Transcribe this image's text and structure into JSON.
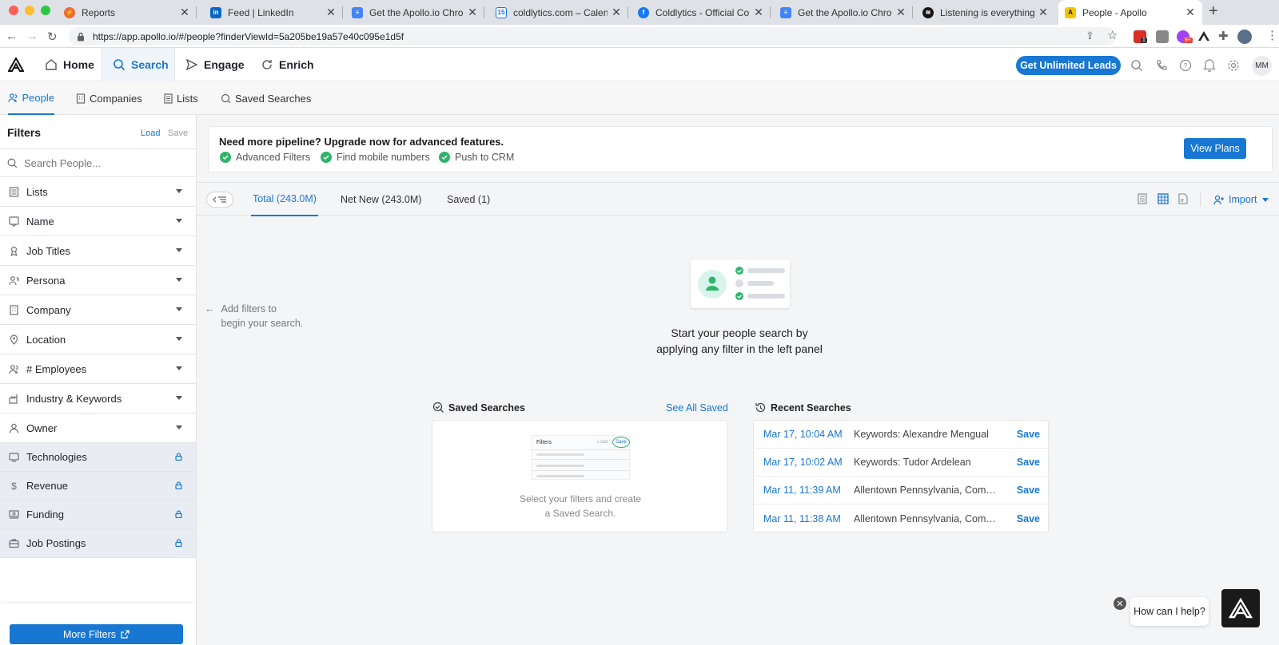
{
  "browser": {
    "tabs": [
      {
        "title": "Reports",
        "favicon": "reports-icon",
        "color": "#f06a35"
      },
      {
        "title": "Feed | LinkedIn",
        "favicon": "linkedin-icon",
        "color": "#0a66c2"
      },
      {
        "title": "Get the Apollo.io Chrome",
        "favicon": "google-docs-icon",
        "color": "#4285f4"
      },
      {
        "title": "coldlytics.com – Calendar",
        "favicon": "google-calendar-icon",
        "color": "#1a73e8"
      },
      {
        "title": "Coldlytics - Official Comm",
        "favicon": "facebook-icon",
        "color": "#1877f2"
      },
      {
        "title": "Get the Apollo.io Chrome",
        "favicon": "google-docs-icon",
        "color": "#4285f4"
      },
      {
        "title": "Listening is everything - S",
        "favicon": "spotify-icon",
        "color": "#191414"
      },
      {
        "title": "People - Apollo",
        "favicon": "apollo-icon",
        "color": "#f5c400"
      }
    ],
    "url": "https://app.apollo.io/#/people?finderViewId=5a205be19a57e40c095e1d5f",
    "ext_badge_1": "1",
    "ext_badge_2": "9+"
  },
  "nav": {
    "home": "Home",
    "search": "Search",
    "engage": "Engage",
    "enrich": "Enrich",
    "cta": "Get Unlimited Leads",
    "avatar": "MM"
  },
  "subnav": {
    "people": "People",
    "companies": "Companies",
    "lists": "Lists",
    "saved_searches": "Saved Searches"
  },
  "filters": {
    "title": "Filters",
    "load": "Load",
    "save": "Save",
    "search_placeholder": "Search People...",
    "items": [
      {
        "label": "Lists",
        "icon": "list-icon",
        "locked": false
      },
      {
        "label": "Name",
        "icon": "name-icon",
        "locked": false
      },
      {
        "label": "Job Titles",
        "icon": "badge-icon",
        "locked": false
      },
      {
        "label": "Persona",
        "icon": "persona-icon",
        "locked": false
      },
      {
        "label": "Company",
        "icon": "building-icon",
        "locked": false
      },
      {
        "label": "Location",
        "icon": "location-icon",
        "locked": false
      },
      {
        "label": "# Employees",
        "icon": "people-icon",
        "locked": false
      },
      {
        "label": "Industry & Keywords",
        "icon": "industry-icon",
        "locked": false
      },
      {
        "label": "Owner",
        "icon": "owner-icon",
        "locked": false
      },
      {
        "label": "Technologies",
        "icon": "technologies-icon",
        "locked": true
      },
      {
        "label": "Revenue",
        "icon": "dollar-icon",
        "locked": true
      },
      {
        "label": "Funding",
        "icon": "funding-icon",
        "locked": true
      },
      {
        "label": "Job Postings",
        "icon": "briefcase-icon",
        "locked": true
      }
    ],
    "more_filters": "More Filters"
  },
  "upgrade": {
    "title": "Need more pipeline? Upgrade now for advanced features.",
    "features": [
      "Advanced Filters",
      "Find mobile numbers",
      "Push to CRM"
    ],
    "button": "View Plans"
  },
  "results_tabs": {
    "total": "Total (243.0M)",
    "net_new": "Net New (243.0M)",
    "saved": "Saved (1)",
    "import": "Import"
  },
  "empty_state": {
    "hint_line1": "Add filters to",
    "hint_line2": "begin your search.",
    "cta_line1": "Start your people search by",
    "cta_line2": "applying any filter in the left panel"
  },
  "saved_searches": {
    "title": "Saved Searches",
    "see_all": "See All Saved",
    "mini_filters": "Filters",
    "mini_load": "Load",
    "mini_save": "Save",
    "msg_line1": "Select your filters and create",
    "msg_line2": "a Saved Search."
  },
  "recent_searches": {
    "title": "Recent Searches",
    "save_label": "Save",
    "rows": [
      {
        "date": "Mar 17, 10:04 AM",
        "keywords": "Keywords: Alexandre Mengual"
      },
      {
        "date": "Mar 17, 10:02 AM",
        "keywords": "Keywords: Tudor Ardelean"
      },
      {
        "date": "Mar 11, 11:39 AM",
        "keywords": "Allentown Pennsylvania, Comp..."
      },
      {
        "date": "Mar 11, 11:38 AM",
        "keywords": "Allentown Pennsylvania, Comp..."
      }
    ]
  },
  "chat": {
    "prompt": "How can I help?"
  },
  "colors": {
    "accent": "#1877d2",
    "success": "#2fb56b"
  }
}
